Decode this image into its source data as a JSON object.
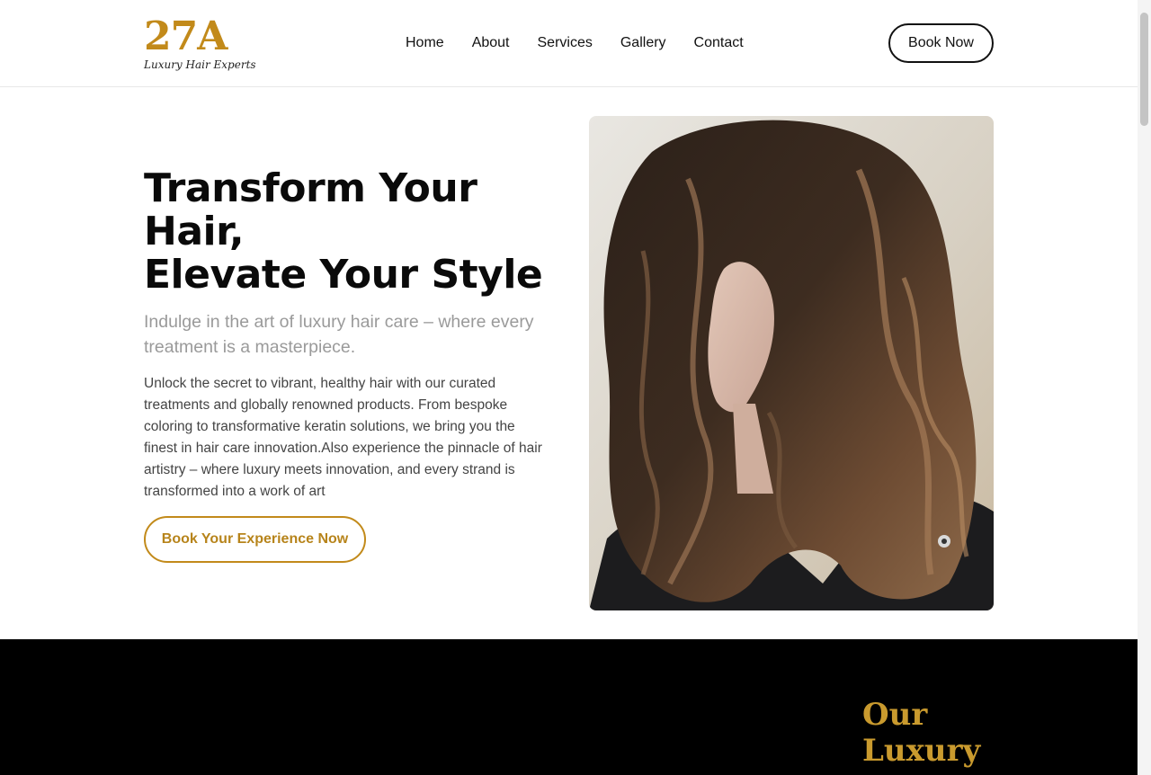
{
  "brand": {
    "logo": "27A",
    "tagline": "Luxury Hair Experts",
    "accent_color": "#c28a1a"
  },
  "nav": {
    "items": [
      {
        "label": "Home"
      },
      {
        "label": "About"
      },
      {
        "label": "Services"
      },
      {
        "label": "Gallery"
      },
      {
        "label": "Contact"
      }
    ],
    "book_label": "Book Now"
  },
  "hero": {
    "title_line1": "Transform Your",
    "title_line2": "Hair,",
    "title_line3": "Elevate Your Style",
    "subtitle": "Indulge in the art of luxury hair care – where every treatment is a masterpiece.",
    "body": "Unlock the secret to vibrant, healthy hair with our curated treatments and globally renowned products. From bespoke coloring to transformative keratin solutions, we bring you the finest in hair care innovation.Also experience the pinnacle of hair artistry – where luxury meets innovation, and every strand is transformed into a work of art",
    "cta_label": "Book Your Experience Now",
    "image_icon": "woman-wavy-hair-photo"
  },
  "services_section": {
    "title": "Our Luxury"
  }
}
